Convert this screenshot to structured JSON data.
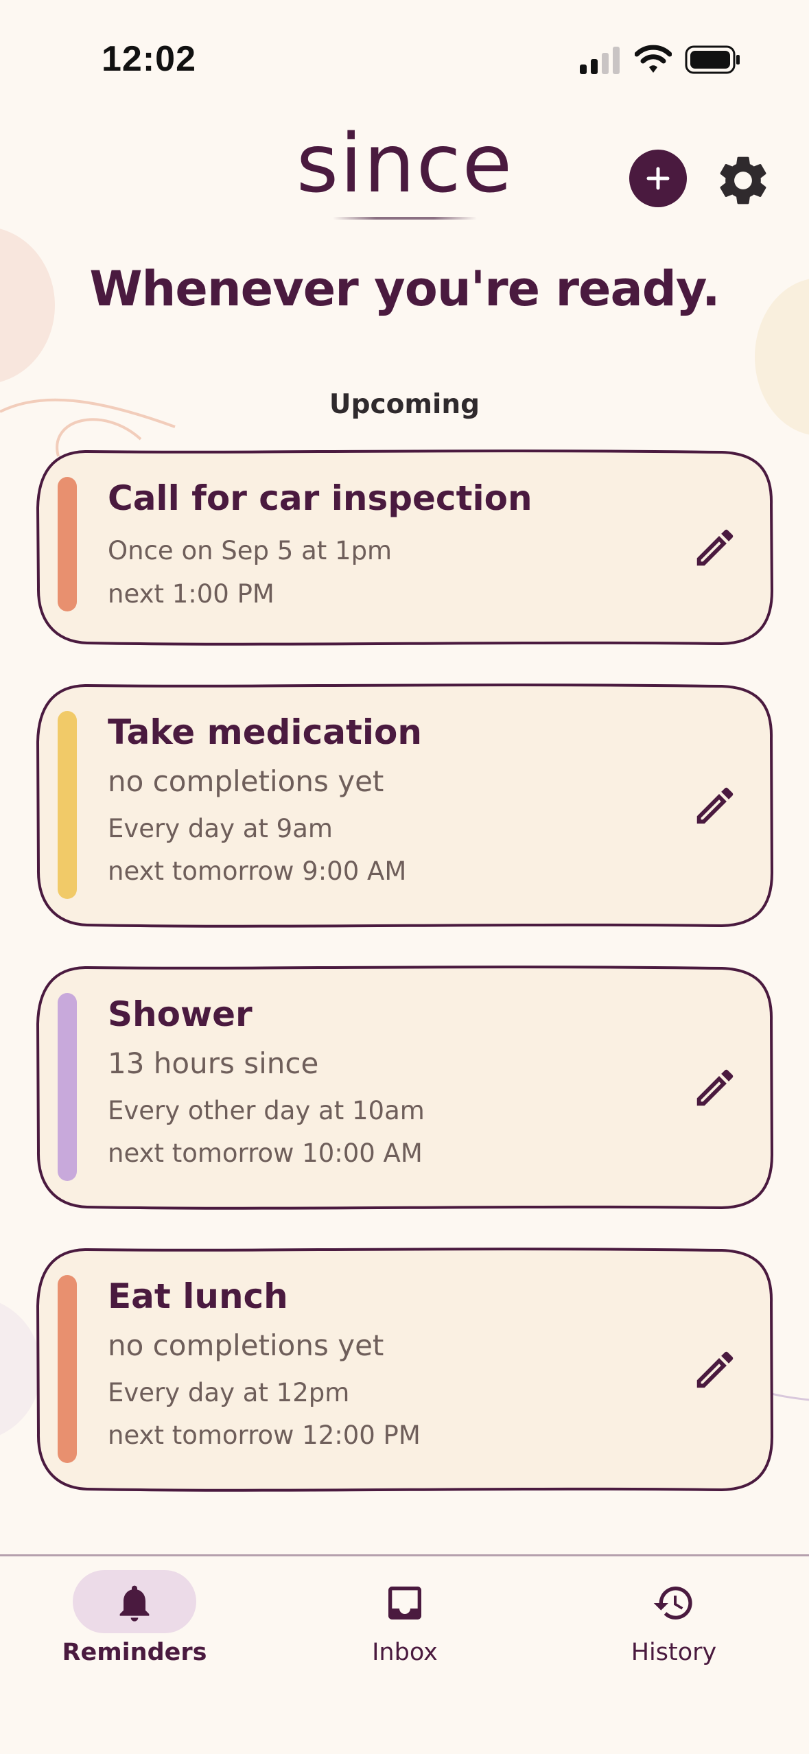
{
  "status_bar": {
    "time": "12:02"
  },
  "header": {
    "logo": "since",
    "add_icon": "plus-circle-icon",
    "settings_icon": "gear-icon"
  },
  "headline": "Whenever you're ready.",
  "section_label": "Upcoming",
  "reminders": [
    {
      "title": "Call for car inspection",
      "lines": [
        "Once on Sep 5 at 1pm",
        "next 1:00 PM"
      ],
      "accent": "#e8906f"
    },
    {
      "title": "Take medication",
      "lines": [
        "no completions yet",
        "Every day at 9am",
        "next tomorrow 9:00 AM"
      ],
      "accent": "#f1ca68"
    },
    {
      "title": "Shower",
      "lines": [
        "13 hours since",
        "Every other day at 10am",
        "next tomorrow 10:00 AM"
      ],
      "accent": "#c8a9db"
    },
    {
      "title": "Eat lunch",
      "lines": [
        "no completions yet",
        "Every day at 12pm",
        "next tomorrow 12:00 PM"
      ],
      "accent": "#e8906f"
    }
  ],
  "nav": {
    "items": [
      {
        "label": "Reminders",
        "icon": "bell-icon",
        "active": true
      },
      {
        "label": "Inbox",
        "icon": "inbox-icon",
        "active": false
      },
      {
        "label": "History",
        "icon": "history-icon",
        "active": false
      }
    ]
  },
  "colors": {
    "background": "#fdf8f2",
    "card": "#faf0e2",
    "primary": "#4a1a3f",
    "nav_active_pill": "#ecdbe8"
  }
}
